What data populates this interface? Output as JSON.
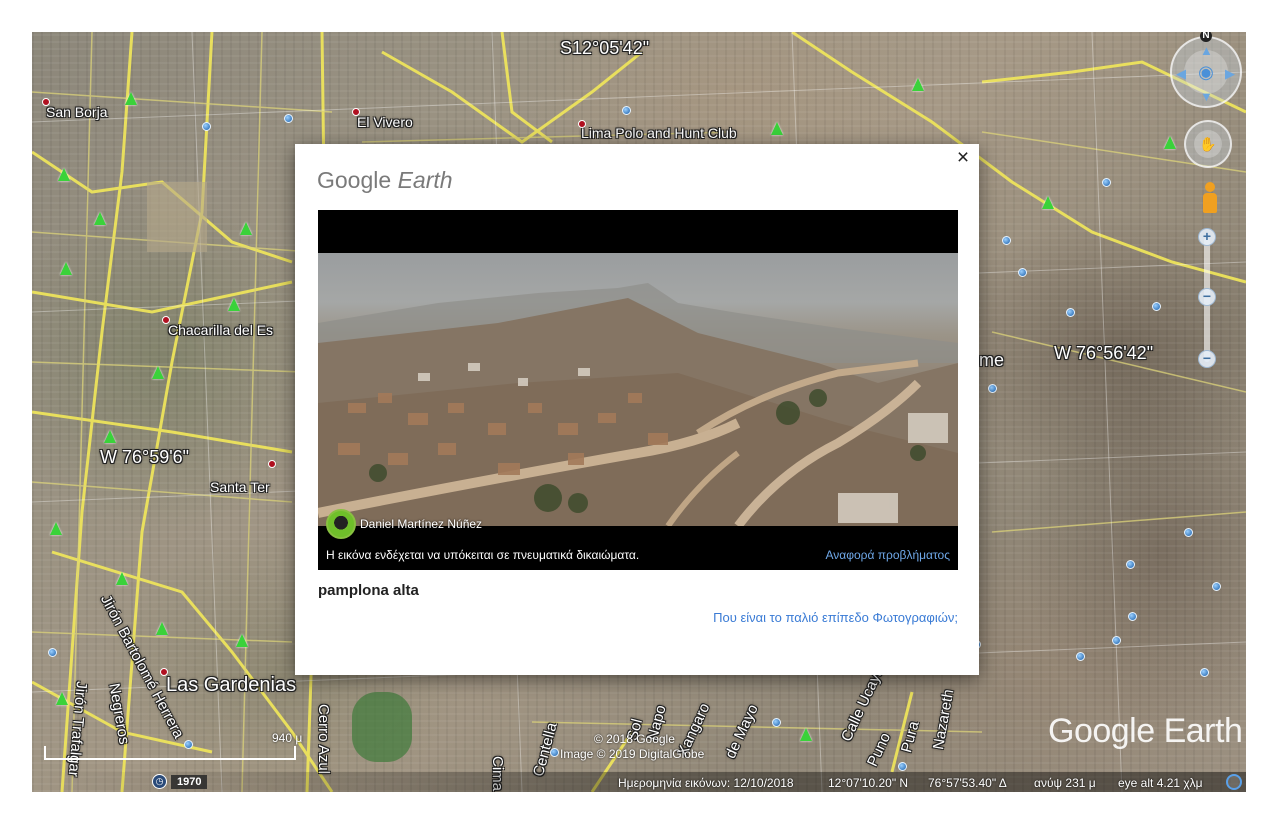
{
  "map": {
    "labels": {
      "san_borja": "San Borja",
      "el_vivero": "El Vivero",
      "lima_polo": "Lima Polo and Hunt Club",
      "chacarilla": "Chacarilla del Es",
      "santa_ter": "Santa Ter",
      "las_gardenias": "Las Gardenias",
      "coord_lat": "S12°05'42\"",
      "coord_w1": "W 76°59'6\"",
      "coord_w2": "W 76°56'42\"",
      "me_fragment": "me",
      "street_bartolome": "Jirón Bartolomé Herrera",
      "street_negreros": "Negreros",
      "street_trafalgar": "Jirón Trafalgar",
      "street_cerro_azul": "Cerro Azul",
      "street_cima": "Cima",
      "street_centella": "Centella",
      "street_mayo": "de Mayo",
      "street_xangaro": "Xangaro",
      "street_ucayali": "Calle Ucayali",
      "street_puno": "Puno",
      "street_pura": "Pura",
      "street_nazareth": "Nazareth",
      "street_sol": "Sol",
      "street_napo": "Napo"
    },
    "watermark": "Google Earth",
    "copyright_line1": "© 2018 Google",
    "copyright_line2": "Image © 2019 DigitalGlobe",
    "scale_label": "940 μ",
    "year": "1970"
  },
  "status": {
    "imagery_date": "Ημερομηνία εικόνων: 12/10/2018",
    "lat": "12°07'10.20\" N",
    "lon": "76°57'53.40\" Δ",
    "elevation": "ανύψ  231 μ",
    "eye_alt": "eye alt  4.21 χλμ"
  },
  "dialog": {
    "logo_google": "Google",
    "logo_earth": "Earth",
    "close": "×",
    "author": "Daniel Martínez Núñez",
    "rights": "Η εικόνα ενδέχεται να υπόκειται σε πνευματικά δικαιώματα.",
    "report": "Αναφορά προβλήματος",
    "place_name": "pamplona alta",
    "old_photos_link": "Που είναι το παλιό επίπεδο Φωτογραφιών;"
  },
  "colors": {
    "road": "#f2e85a",
    "link": "#3a7bd5",
    "report_link": "#6fa8e8"
  }
}
